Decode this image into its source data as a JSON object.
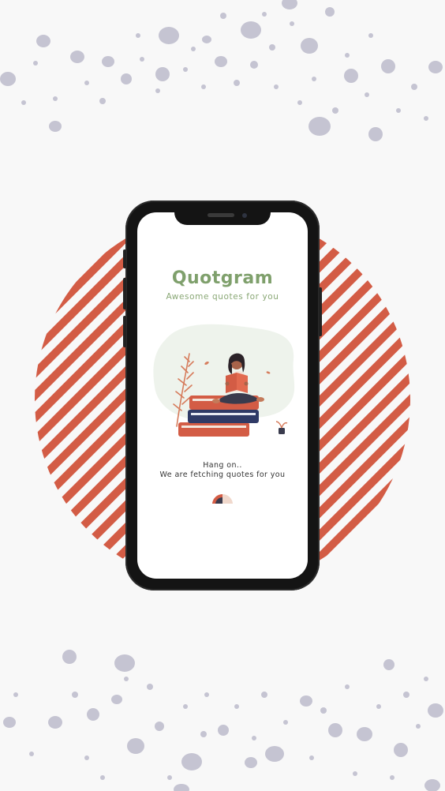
{
  "app": {
    "title": "Quotgram",
    "subtitle": "Awesome quotes for you"
  },
  "loading": {
    "line1": "Hang on..",
    "line2": "We are fetching quotes for you"
  },
  "colors": {
    "background": "#f8f8f8",
    "stripe": "#d35c45",
    "dots": "#c5c4d2",
    "title_green": "#7fa06c",
    "phone_frame": "#141414",
    "book_orange": "#d35c45",
    "book_navy": "#2f3a66"
  },
  "icons": {
    "loading_spinner": "half-circle-spinner-icon"
  }
}
